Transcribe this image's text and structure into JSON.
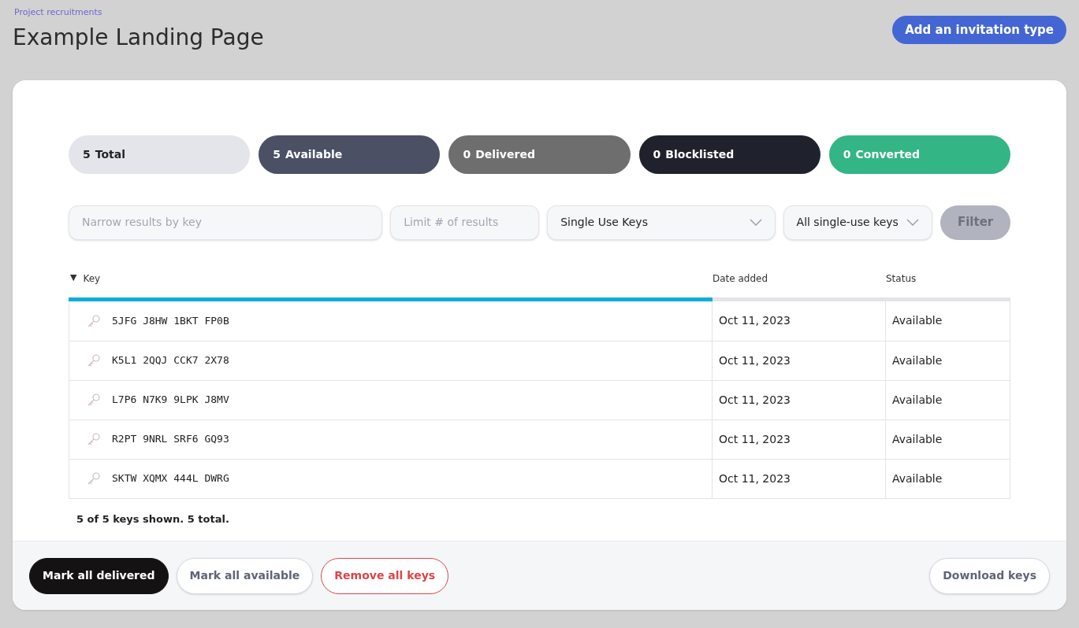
{
  "header": {
    "breadcrumb": "Project recruitments",
    "title": "Example Landing Page",
    "action": "Add an invitation type"
  },
  "stats": [
    {
      "count": "5",
      "label": "Total",
      "kind": "total"
    },
    {
      "count": "5",
      "label": "Available",
      "kind": "available"
    },
    {
      "count": "0",
      "label": "Delivered",
      "kind": "delivered"
    },
    {
      "count": "0",
      "label": "Blocklisted",
      "kind": "blocklisted"
    },
    {
      "count": "0",
      "label": "Converted",
      "kind": "converted"
    }
  ],
  "filters": {
    "key_search": {
      "placeholder": "Narrow results by key"
    },
    "limit": {
      "placeholder": "Limit # of results"
    },
    "key_type": {
      "value": "Single Use Keys"
    },
    "key_scope": {
      "value": "All single-use keys"
    },
    "button": {
      "label": "Filter",
      "disabled": true
    }
  },
  "table": {
    "columns": [
      {
        "label": "Key",
        "sort_icon": "▼",
        "sorted": true
      },
      {
        "label": "Date added",
        "sorted": false
      },
      {
        "label": "Status",
        "sorted": false
      }
    ],
    "rows": [
      {
        "key": "5JFG J8HW 1BKT FP0B",
        "date": "Oct 11, 2023",
        "status": "Available"
      },
      {
        "key": "K5L1 2QQJ CCK7 2X78",
        "date": "Oct 11, 2023",
        "status": "Available"
      },
      {
        "key": "L7P6 N7K9 9LPK J8MV",
        "date": "Oct 11, 2023",
        "status": "Available"
      },
      {
        "key": "R2PT 9NRL SRF6 GQ93",
        "date": "Oct 11, 2023",
        "status": "Available"
      },
      {
        "key": "SKTW XQMX 444L DWRG",
        "date": "Oct 11, 2023",
        "status": "Available"
      }
    ],
    "summary": "5 of 5 keys shown. 5 total."
  },
  "footer": {
    "actions": [
      {
        "label": "Mark all delivered",
        "kind": "primary"
      },
      {
        "label": "Mark all available",
        "kind": "secondary"
      },
      {
        "label": "Remove all keys",
        "kind": "danger"
      }
    ],
    "download": "Download keys"
  }
}
